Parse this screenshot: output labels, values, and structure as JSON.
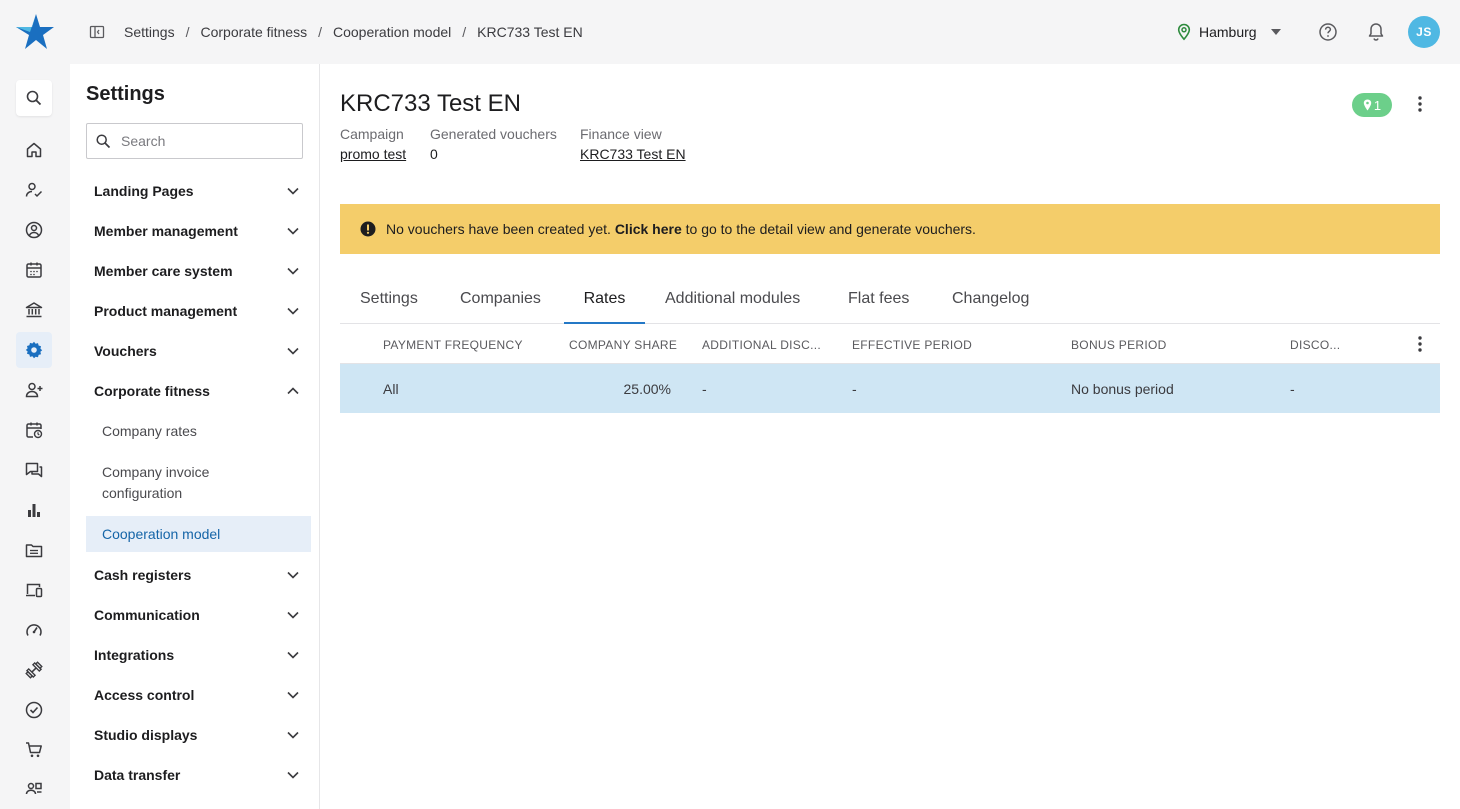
{
  "breadcrumb": [
    "Settings",
    "Corporate fitness",
    "Cooperation model",
    "KRC733 Test EN"
  ],
  "location": "Hamburg",
  "user_initials": "JS",
  "rail_icons": [
    "search-icon",
    "home-icon",
    "user-check-icon",
    "user-circle-icon",
    "calendar-icon",
    "bank-icon",
    "gear-icon",
    "user-plus-icon",
    "calendar-clock-icon",
    "chat-icon",
    "bar-chart-icon",
    "folder-icon",
    "devices-icon",
    "gauge-icon",
    "dumbbell-icon",
    "check-circle-icon",
    "cart-icon",
    "people-icon"
  ],
  "settings": {
    "title": "Settings",
    "search_placeholder": "Search",
    "nav": [
      {
        "label": "Landing Pages",
        "expanded": false
      },
      {
        "label": "Member management",
        "expanded": false
      },
      {
        "label": "Member care system",
        "expanded": false
      },
      {
        "label": "Product management",
        "expanded": false
      },
      {
        "label": "Vouchers",
        "expanded": false
      },
      {
        "label": "Corporate fitness",
        "expanded": true
      },
      {
        "label": "Cash registers",
        "expanded": false
      },
      {
        "label": "Communication",
        "expanded": false
      },
      {
        "label": "Integrations",
        "expanded": false
      },
      {
        "label": "Access control",
        "expanded": false
      },
      {
        "label": "Studio displays",
        "expanded": false
      },
      {
        "label": "Data transfer",
        "expanded": false
      }
    ],
    "sub_items": [
      "Company rates",
      "Company invoice configuration",
      "Cooperation model"
    ]
  },
  "page": {
    "title": "KRC733 Test EN",
    "badge_count": "1",
    "meta": [
      {
        "label": "Campaign",
        "value": "promo test",
        "link": true
      },
      {
        "label": "Generated vouchers",
        "value": "0",
        "link": false
      },
      {
        "label": "Finance view",
        "value": "KRC733 Test EN",
        "link": true
      }
    ],
    "alert": {
      "text_before": "No vouchers have been created yet.",
      "link_text": "Click here",
      "text_after": "to go to the detail view and generate vouchers."
    },
    "tabs": [
      "Settings",
      "Companies",
      "Rates",
      "Additional modules",
      "Flat fees",
      "Changelog"
    ],
    "active_tab": "Rates"
  },
  "table": {
    "headers": [
      "PAYMENT FREQUENCY",
      "COMPANY SHARE",
      "ADDITIONAL DISC...",
      "EFFECTIVE PERIOD",
      "BONUS PERIOD",
      "DISCO..."
    ],
    "rows": [
      [
        "All",
        "25.00%",
        "-",
        "-",
        "No bonus period",
        "-"
      ]
    ]
  },
  "colors": {
    "accent": "#2478c6",
    "alert_bg": "#f4cd6a",
    "badge_bg": "#6ccf8a",
    "avatar_bg": "#4fb8e3",
    "selected_row": "#cfe6f4"
  }
}
